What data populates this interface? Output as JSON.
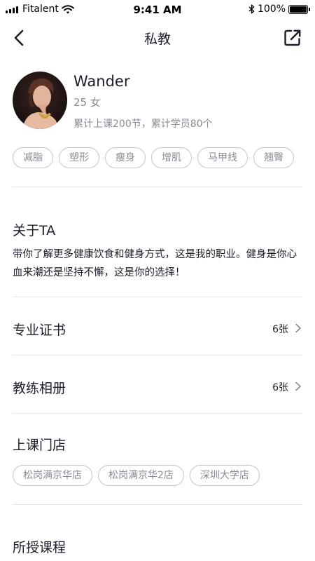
{
  "status_bar": {
    "carrier": "Fitalent",
    "time": "9:41 AM",
    "battery_text": "100%",
    "battery_level": 1.0
  },
  "nav": {
    "title": "私教"
  },
  "profile": {
    "name": "Wander",
    "meta": "25 女",
    "stats": "累计上课200节，累计学员80个"
  },
  "tags": [
    "减脂",
    "塑形",
    "瘦身",
    "增肌",
    "马甲线",
    "翘臀"
  ],
  "about": {
    "title": "关于TA",
    "text": "带你了解更多健康饮食和健身方式，这是我的职业。健身是你心血来潮还是坚持不懈，这是你的选择！"
  },
  "certificates": {
    "label": "专业证书",
    "count": "6张"
  },
  "album": {
    "label": "教练相册",
    "count": "6张"
  },
  "stores": {
    "title": "上课门店",
    "items": [
      "松岗满京华店",
      "松岗满京华2店",
      "深圳大学店"
    ]
  },
  "courses": {
    "title": "所授课程"
  },
  "colors": {
    "primary_text": "#1d1d2b",
    "secondary_text": "#8a8a94",
    "tag_border": "#c4c4cc",
    "divider": "#e8e8ec"
  },
  "icons": {
    "back": "chevron-left-icon",
    "share": "share-icon",
    "chevron": "chevron-right-icon",
    "bluetooth": "bluetooth-icon",
    "wifi": "wifi-icon"
  }
}
